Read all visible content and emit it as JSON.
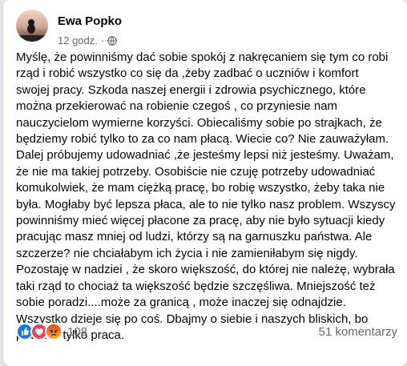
{
  "post": {
    "author": "Ewa Popko",
    "time": "12 godz.",
    "separator": "·",
    "privacy_icon": "globe-icon",
    "text": "Myślę, że powinniśmy dać sobie spokój z nakręcaniem się tym co robi\nrząd i robić wszystko co się da ,żeby zadbać o uczniów i komfort\nswojej pracy. Szkoda naszej energii i zdrowia psychicznego, które\nmożna przekierować na robienie czegoś , co przyniesie nam\nnauczycielom wymierne korzyści. Obiecaliśmy sobie po strajkach, że\nbędziemy robić tylko to za co nam płacą. Wiecie co? Nie zauważyłam.\nDalej próbujemy udowadniać ,że jesteśmy lepsi niż jesteśmy. Uważam,\nże nie ma takiej potrzeby. Osobiście nie czuję potrzeby udowadniać\nkomukolwiek, że mam ciężką pracę, bo robię wszystko, żeby taka nie\nbyła. Mogłaby być lepsza płaca, ale to nie tylko nasz problem. Wszyscy\npowinniśmy mieć więcej płacone za pracę, aby nie było sytuacji  kiedy\npracując masz mniej od ludzi, którzy są na garnuszku państwa. Ale\nszczerze? nie chciałabym ich życia i nie zamieniłabym się nigdy.\nPozostaję w nadziei , że skoro większość, do której nie należę, wybrała\ntaki rząd to chociaż ta większość będzie szczęśliwa. Mniejszość też\nsobie poradzi....może za granicą , może inaczej się odnajdzie.\nWszystko dzieje się po coś. Dbajmy o siebie i naszych bliskich, bo\npraca to tylko praca."
  },
  "footer": {
    "reactions": [
      {
        "name": "like-reaction-icon",
        "color": "#1877f2"
      },
      {
        "name": "love-reaction-icon",
        "color": "#f33e58"
      },
      {
        "name": "angry-reaction-icon",
        "color": "#f7b125"
      }
    ],
    "reaction_count": "108",
    "comments": "51 komentarzy"
  }
}
